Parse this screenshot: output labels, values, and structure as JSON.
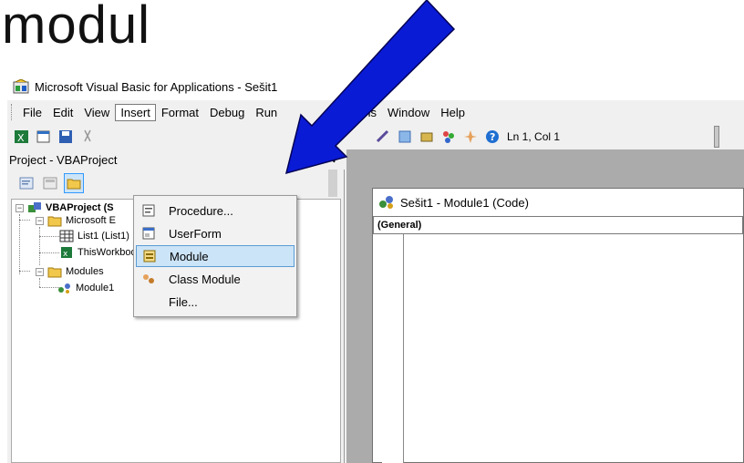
{
  "heading": "modul",
  "window": {
    "title": "Microsoft Visual Basic for Applications - Sešit1"
  },
  "menubar": [
    {
      "label": "File"
    },
    {
      "label": "Edit"
    },
    {
      "label": "View"
    },
    {
      "label": "Insert"
    },
    {
      "label": "Format"
    },
    {
      "label": "Debug"
    },
    {
      "label": "Run"
    },
    {
      "label": "Add-Ins"
    },
    {
      "label": "Window"
    },
    {
      "label": "Help"
    }
  ],
  "toolbar": {
    "status": "Ln 1, Col 1"
  },
  "insert_menu": [
    {
      "label": "Procedure..."
    },
    {
      "label": "UserForm"
    },
    {
      "label": "Module"
    },
    {
      "label": "Class Module"
    },
    {
      "label": "File..."
    }
  ],
  "project": {
    "header": "Project - VBAProject",
    "tree": {
      "root": "VBAProject (S",
      "excel_objects": "Microsoft E",
      "sheet1": "List1 (List1)",
      "workbook": "ThisWorkbook",
      "modules_folder": "Modules",
      "module1": "Module1"
    }
  },
  "code_window": {
    "title": "Sešit1 - Module1 (Code)",
    "object_combo": "(General)"
  },
  "colors": {
    "arrow": "#0a1bd6",
    "highlight": "#cce4f7",
    "mdi_background": "#ababab"
  }
}
